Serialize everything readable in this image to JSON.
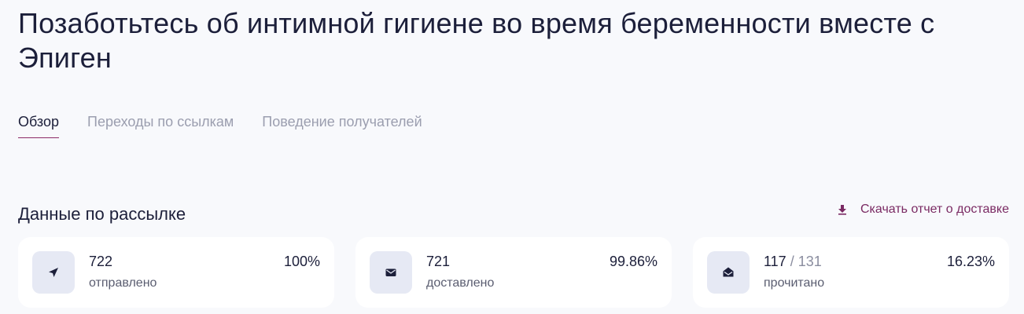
{
  "page": {
    "title": "Позаботьтесь об интимной гигиене во время беременности вместе с Эпиген"
  },
  "tabs": [
    {
      "label": "Обзор",
      "active": true
    },
    {
      "label": "Переходы по ссылкам",
      "active": false
    },
    {
      "label": "Поведение получателей",
      "active": false
    }
  ],
  "section": {
    "title": "Данные по рассылке",
    "download_label": "Скачать отчет о доставке",
    "download_icon": "download-icon"
  },
  "cards": [
    {
      "icon": "send-icon",
      "value": "722",
      "label": "отправлено",
      "percent": "100%"
    },
    {
      "icon": "envelope-icon",
      "value": "721",
      "label": "доставлено",
      "percent": "99.86%"
    },
    {
      "icon": "envelope-open-icon",
      "value": "117",
      "total": " / 131",
      "label": "прочитано",
      "percent": "16.23%"
    }
  ],
  "colors": {
    "accent": "#8c2a67",
    "text": "#1c1f3a",
    "muted": "#9b9eaf",
    "background": "#f8f9fc",
    "icon_bg": "#e6e9f4"
  }
}
